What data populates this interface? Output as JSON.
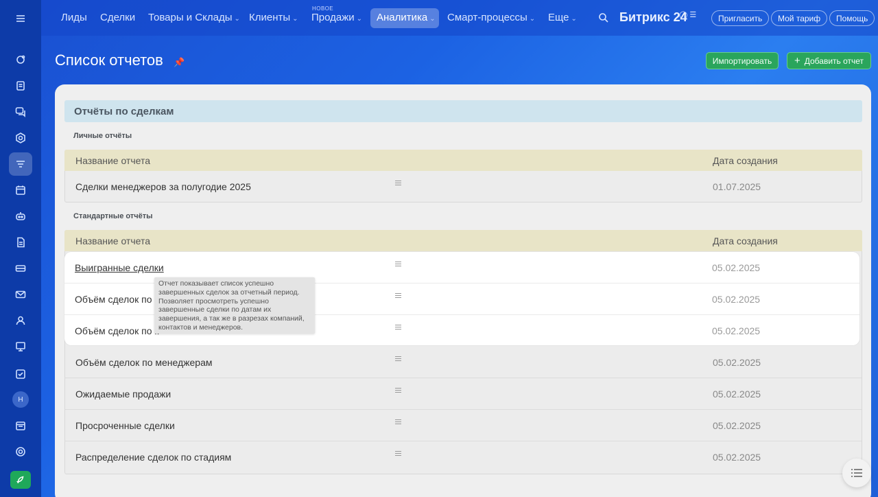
{
  "nav": {
    "items": [
      {
        "label": "Лиды",
        "dropdown": false
      },
      {
        "label": "Сделки",
        "dropdown": false
      },
      {
        "label": "Товары и Склады",
        "dropdown": true
      },
      {
        "label": "Клиенты",
        "dropdown": true
      },
      {
        "label": "Продажи",
        "dropdown": true,
        "badge": "НОВОЕ"
      },
      {
        "label": "Аналитика",
        "dropdown": true,
        "active": true
      },
      {
        "label": "Смарт-процессы",
        "dropdown": true
      },
      {
        "label": "Еще",
        "dropdown": true
      }
    ],
    "brand": "Битрикс 24",
    "invite_label": "Пригласить",
    "tariff_label": "Мой тариф",
    "help_label": "Помощь"
  },
  "sidebar": {
    "icons": [
      "activity-icon",
      "feed-icon",
      "chat-icon",
      "hexagon-icon",
      "crm-funnel-icon",
      "calendar-icon",
      "robot-icon",
      "document-icon",
      "card-icon",
      "mail-icon",
      "contacts-icon",
      "presentation-icon",
      "tasks-icon",
      "avatar",
      "schedule-icon",
      "settings-icon",
      "rocket-icon"
    ],
    "avatar_initial": "Н"
  },
  "page": {
    "title": "Список отчетов",
    "import_label": "Импортировать",
    "add_label": "Добавить отчет"
  },
  "section": {
    "title": "Отчёты по сделкам",
    "personal_label": "Личные отчёты",
    "standard_label": "Стандартные отчёты",
    "col_name": "Название отчета",
    "col_date": "Дата создания",
    "personal_rows": [
      {
        "name": "Сделки менеджеров за полугодие 2025",
        "date": "01.07.2025"
      }
    ],
    "standard_rows": [
      {
        "name": "Выигранные сделки",
        "date": "05.02.2025"
      },
      {
        "name": "Объём сделок по к",
        "date": "05.02.2025"
      },
      {
        "name": "Объём сделок по к",
        "date": "05.02.2025"
      },
      {
        "name": "Объём сделок по менеджерам",
        "date": "05.02.2025"
      },
      {
        "name": "Ожидаемые продажи",
        "date": "05.02.2025"
      },
      {
        "name": "Просроченные сделки",
        "date": "05.02.2025"
      },
      {
        "name": "Распределение сделок по стадиям",
        "date": "05.02.2025"
      }
    ]
  },
  "tooltip": {
    "text": "Отчет показывает список успешно завершенных сделок за отчетный период. Позволяет просмотреть успешно завершенные сделки по датам их завершения, а так же в разрезах компаний, контактов и менеджеров."
  },
  "colors": {
    "accent_green": "#2aa55c",
    "header_blue": "#1c62e3",
    "section_bar": "#cfe4ee",
    "table_head": "#e8e4c7"
  }
}
